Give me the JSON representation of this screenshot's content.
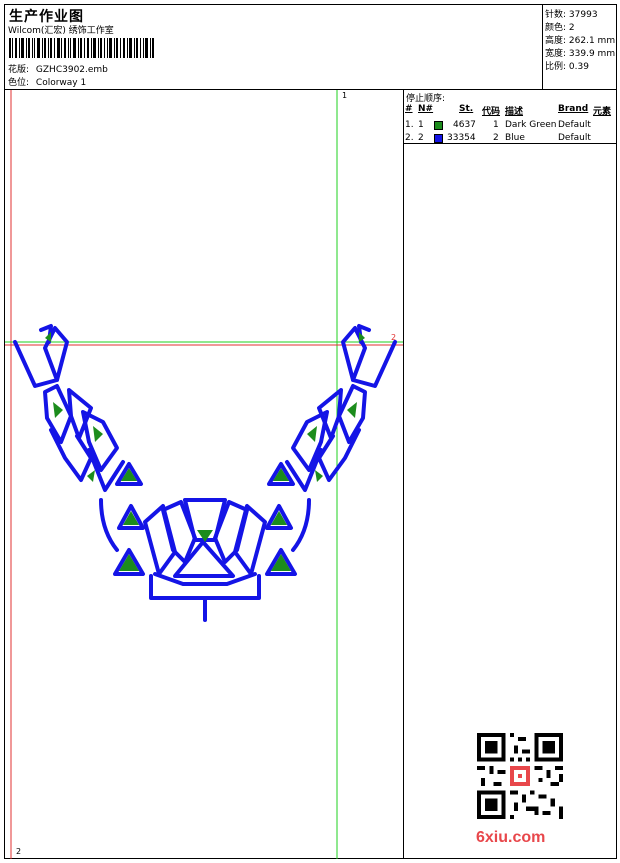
{
  "header": {
    "title": "生产作业图",
    "company": "Wilcom(汇宏) 绣饰工作室",
    "design_label": "花版:",
    "design_value": "GZHC3902.emb",
    "colorway_label": "色位:",
    "colorway_value": "Colorway 1"
  },
  "stats": [
    {
      "label": "针数:",
      "value": "37993"
    },
    {
      "label": "颜色:",
      "value": "2"
    },
    {
      "label": "高度:",
      "value": "262.1 mm"
    },
    {
      "label": "宽度:",
      "value": "339.9 mm"
    },
    {
      "label": "比例:",
      "value": "0.39"
    }
  ],
  "stop_sequence": {
    "title": "停止顺序:",
    "headers": [
      "#",
      "N#",
      "St.",
      "代码",
      "描述",
      "Brand",
      "元素"
    ],
    "rows": [
      {
        "num": "1.",
        "n": "1",
        "color": "#1c8c1c",
        "stitches": "4637",
        "code": "1",
        "desc": "Dark Green",
        "brand": "Default"
      },
      {
        "num": "2.",
        "n": "2",
        "color": "#1414e6",
        "stitches": "33354",
        "code": "2",
        "desc": "Blue",
        "brand": "Default"
      }
    ]
  },
  "canvas": {
    "marker_top": "1",
    "marker_right": "2",
    "marker_bottom": "2"
  },
  "watermark": "6xiu.com",
  "colors": {
    "guide_red": "#e03030",
    "guide_green": "#1fd11f",
    "thread_blue": "#1414e6",
    "thread_green": "#1c8c1c"
  }
}
